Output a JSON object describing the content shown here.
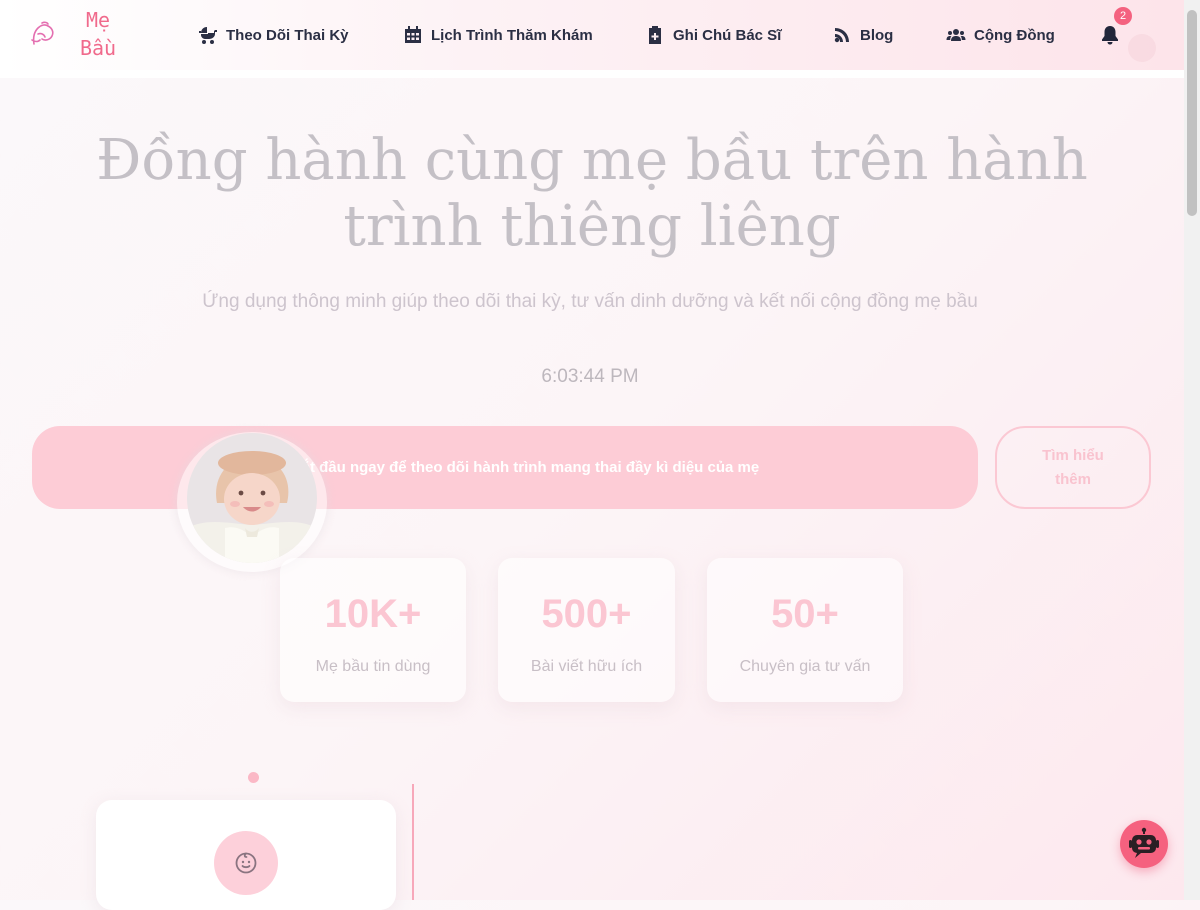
{
  "brand": {
    "logo_text_line1": "Mẹ",
    "logo_text_line2": "Bầu"
  },
  "nav": [
    {
      "label": "Theo Dõi Thai Kỳ",
      "icon": "baby-carriage-icon"
    },
    {
      "label": "Lịch Trình Thăm Khám",
      "icon": "calendar-icon"
    },
    {
      "label": "Ghi Chú Bác Sĩ",
      "icon": "medical-clipboard-icon"
    },
    {
      "label": "Blog",
      "icon": "blog-feed-icon"
    },
    {
      "label": "Cộng Đồng",
      "icon": "users-icon"
    }
  ],
  "notifications": {
    "count": "2",
    "icon": "bell-icon"
  },
  "hero": {
    "title": "Đồng hành cùng mẹ bầu trên hành trình thiêng liêng",
    "subtitle": "Ứng dụng thông minh giúp theo dõi thai kỳ, tư vấn dinh dưỡng và kết nối cộng đồng mẹ bầu",
    "clock": "6:03:44 PM",
    "cta_label": "Bắt đầu ngay để theo dõi hành trình mang thai đầy kì diệu của mẹ",
    "learn_more_label": "Tìm hiểu thêm"
  },
  "stats": [
    {
      "value": "10K+",
      "label": "Mẹ bầu tin dùng"
    },
    {
      "value": "500+",
      "label": "Bài viết hữu ích"
    },
    {
      "value": "50+",
      "label": "Chuyên gia tư vấn"
    }
  ],
  "features": [
    {
      "icon": "baby-face-icon"
    }
  ],
  "chatbot": {
    "icon": "robot-icon"
  },
  "colors": {
    "accent": "#f5617f",
    "nav_text": "#2b2f44",
    "stat_number": "#fbc6d2"
  }
}
